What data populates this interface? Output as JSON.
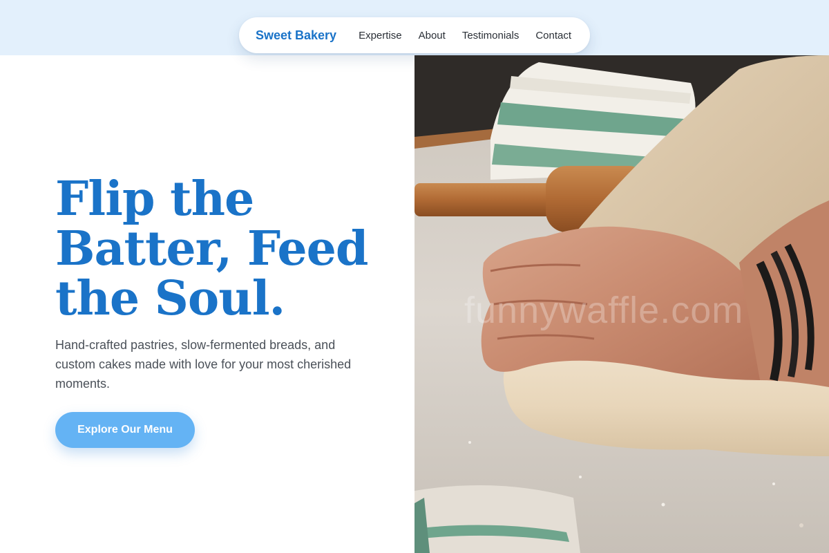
{
  "nav": {
    "brand": "Sweet Bakery",
    "links": [
      "Expertise",
      "About",
      "Testimonials",
      "Contact"
    ]
  },
  "hero": {
    "headline": "Flip the Batter, Feed the Soul.",
    "subtext": "Hand-crafted pastries, slow-fermented breads, and custom cakes made with love for your most cherished moments.",
    "cta_label": "Explore Our Menu",
    "image_watermark": "funnywaffle.com"
  },
  "colors": {
    "brand": "#1a73c8",
    "header_background": "#e3f0fc",
    "cta_background": "#64b3f4",
    "body_text": "#4a5058"
  }
}
